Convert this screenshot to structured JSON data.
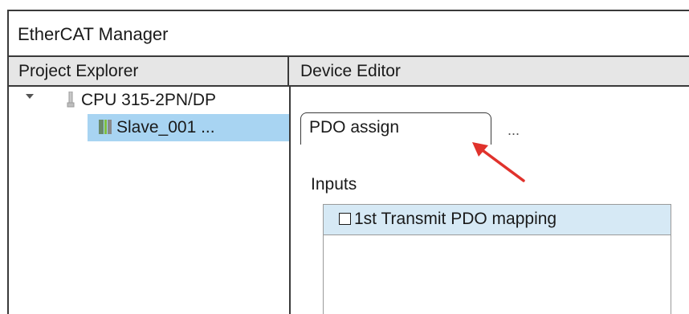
{
  "window": {
    "title": "EtherCAT Manager"
  },
  "panes": {
    "left_header": "Project Explorer",
    "right_header": "Device Editor"
  },
  "tree": {
    "root": {
      "label": "CPU 315-2PN/DP",
      "expanded": true,
      "icon": "cpu-icon"
    },
    "child": {
      "label": "Slave_001 ...",
      "selected": true,
      "icon": "slave-device-icon"
    }
  },
  "editor": {
    "active_tab": "PDO assign",
    "more_tabs": "...",
    "section_label": "Inputs",
    "pdo_items": [
      {
        "label": "1st Transmit PDO mapping",
        "checked": false
      }
    ]
  },
  "annotation": {
    "arrow_color": "#e0322c"
  },
  "colors": {
    "selection": "#a8d4f2",
    "list_highlight": "#d6e9f5",
    "header_bg": "#e6e6e6"
  }
}
